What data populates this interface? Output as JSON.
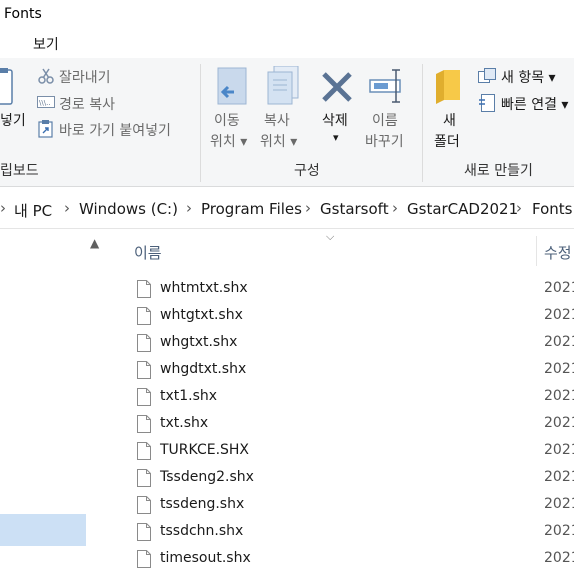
{
  "window": {
    "title": "Fonts"
  },
  "menu": {
    "view_tab": "보기"
  },
  "ribbon": {
    "clipboard": {
      "paste_fragment": "넣기",
      "cut": "잘라내기",
      "copy_path": "경로 복사",
      "paste_shortcut": "바로 가기 붙여넣기",
      "group_label": "립보드"
    },
    "organize": {
      "move_to": [
        "이동",
        "위치"
      ],
      "copy_to": [
        "복사",
        "위치"
      ],
      "delete": "삭제",
      "rename": [
        "이름",
        "바꾸기"
      ],
      "group_label": "구성"
    },
    "new": {
      "new_folder": [
        "새",
        "폴더"
      ],
      "new_item": "새 항목",
      "easy_access": "빠른 연결",
      "group_label": "새로 만들기"
    }
  },
  "breadcrumb": [
    "내 PC",
    "Windows  (C:)",
    "Program Files",
    "Gstarsoft",
    "GstarCAD2021",
    "Fonts"
  ],
  "columns": {
    "name": "이름",
    "modified": "수정"
  },
  "files": [
    {
      "name": "whtmtxt.shx",
      "date": "2021"
    },
    {
      "name": "whtgtxt.shx",
      "date": "2021"
    },
    {
      "name": "whgtxt.shx",
      "date": "2021"
    },
    {
      "name": "whgdtxt.shx",
      "date": "2021"
    },
    {
      "name": "txt1.shx",
      "date": "2021"
    },
    {
      "name": "txt.shx",
      "date": "2021"
    },
    {
      "name": "TURKCE.SHX",
      "date": "2021"
    },
    {
      "name": "Tssdeng2.shx",
      "date": "2021"
    },
    {
      "name": "tssdeng.shx",
      "date": "2021"
    },
    {
      "name": "tssdchn.shx",
      "date": "2021"
    },
    {
      "name": "timesout.shx",
      "date": "2021"
    }
  ],
  "colors": {
    "accent": "#cce0f5",
    "folder": "#f7c948",
    "header_text": "#4c607a",
    "icon_blue": "#6b9bd1"
  }
}
